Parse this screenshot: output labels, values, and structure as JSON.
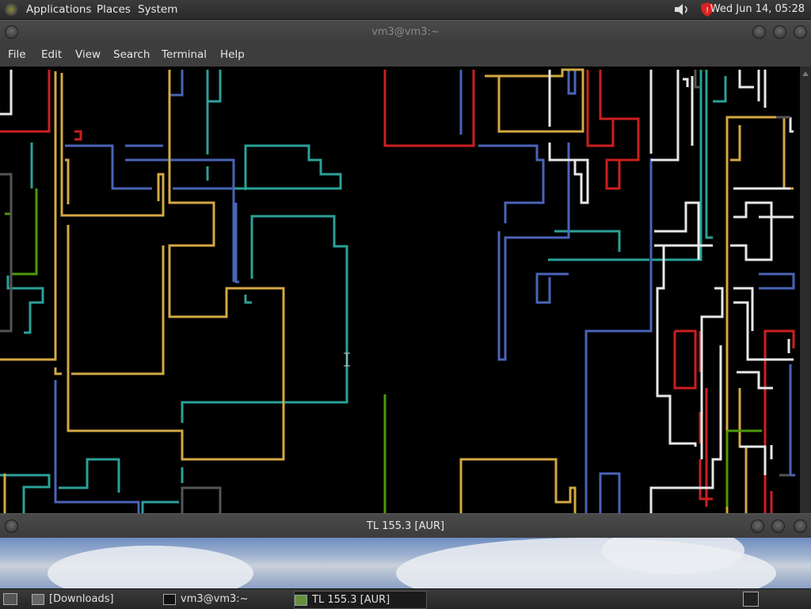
{
  "top_panel": {
    "menus": [
      "Applications",
      "Places",
      "System"
    ],
    "clock": "Wed Jun 14, 05:28"
  },
  "terminal_window": {
    "title": "vm3@vm3:~",
    "menus": [
      "File",
      "Edit",
      "View",
      "Search",
      "Terminal",
      "Help"
    ]
  },
  "second_window": {
    "title": "TL 155.3 [AUR]"
  },
  "taskbar": {
    "tasks": [
      "[Downloads]",
      "vm3@vm3:~",
      "TL 155.3 [AUR]"
    ]
  },
  "colors": {
    "teal": "#2aa198",
    "blue": "#4a64b8",
    "yellow": "#d4a843",
    "red": "#cc1f1f",
    "white": "#e8e8e8",
    "green": "#4e9a06",
    "grey": "#555555"
  }
}
